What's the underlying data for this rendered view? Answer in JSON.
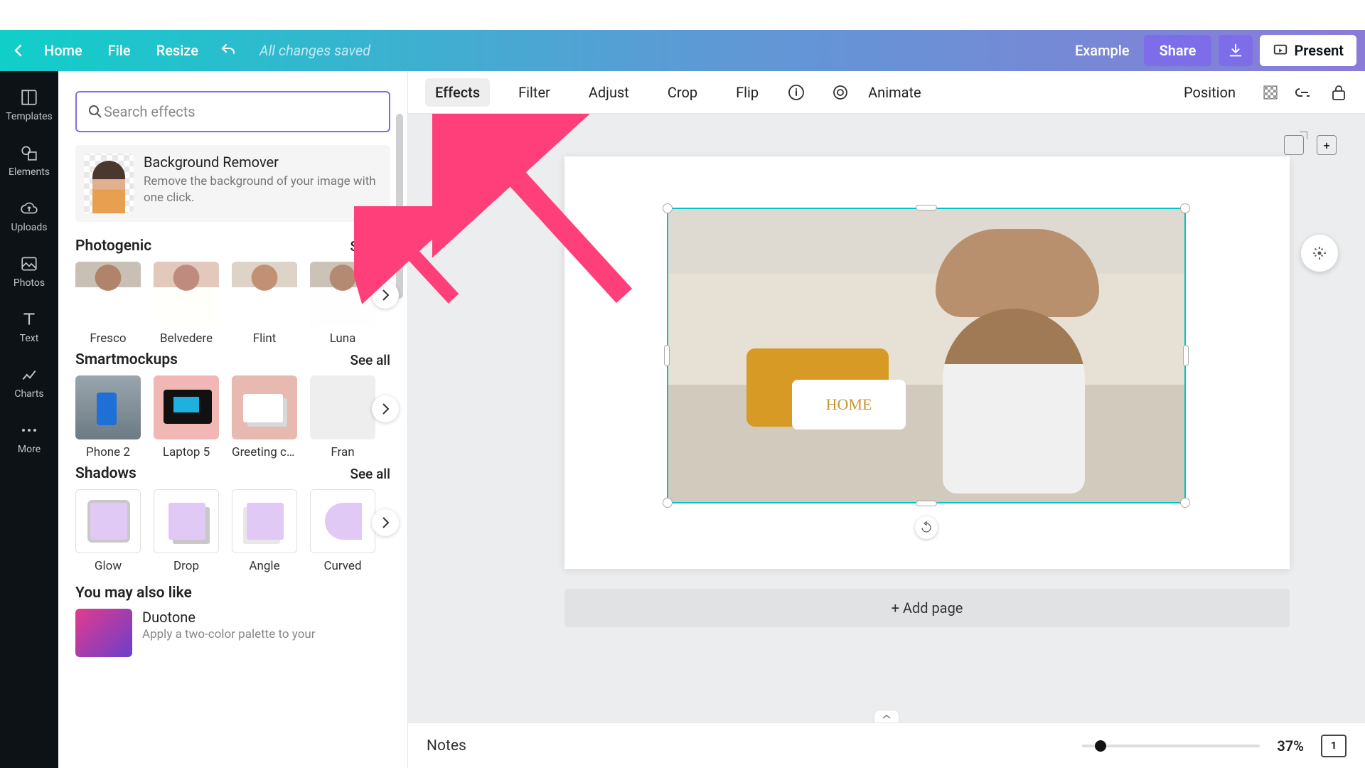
{
  "header": {
    "home": "Home",
    "file": "File",
    "resize": "Resize",
    "status": "All changes saved",
    "example": "Example",
    "share": "Share",
    "present": "Present"
  },
  "rail": {
    "templates": "Templates",
    "elements": "Elements",
    "uploads": "Uploads",
    "photos": "Photos",
    "text": "Text",
    "charts": "Charts",
    "more": "More"
  },
  "panel": {
    "search_placeholder": "Search effects",
    "bg_remover": {
      "title": "Background Remover",
      "desc": "Remove the background of your image with one click."
    },
    "photogenic": {
      "title": "Photogenic",
      "see_all": "See all",
      "items": [
        "Fresco",
        "Belvedere",
        "Flint",
        "Luna"
      ]
    },
    "smartmockups": {
      "title": "Smartmockups",
      "see_all": "See all",
      "items": [
        "Phone 2",
        "Laptop 5",
        "Greeting car…",
        "Fran"
      ]
    },
    "shadows": {
      "title": "Shadows",
      "see_all": "See all",
      "items": [
        "Glow",
        "Drop",
        "Angle",
        "Curved"
      ]
    },
    "likes": {
      "title": "You may also like",
      "item_title": "Duotone",
      "item_desc": "Apply a two-color palette to your"
    }
  },
  "ctx": {
    "effects": "Effects",
    "filter": "Filter",
    "adjust": "Adjust",
    "crop": "Crop",
    "flip": "Flip",
    "animate": "Animate",
    "position": "Position"
  },
  "canvas": {
    "pillow_text": "HOME",
    "add_page": "+ Add page"
  },
  "footer": {
    "notes": "Notes",
    "zoom": "37%",
    "page_count": "1"
  }
}
